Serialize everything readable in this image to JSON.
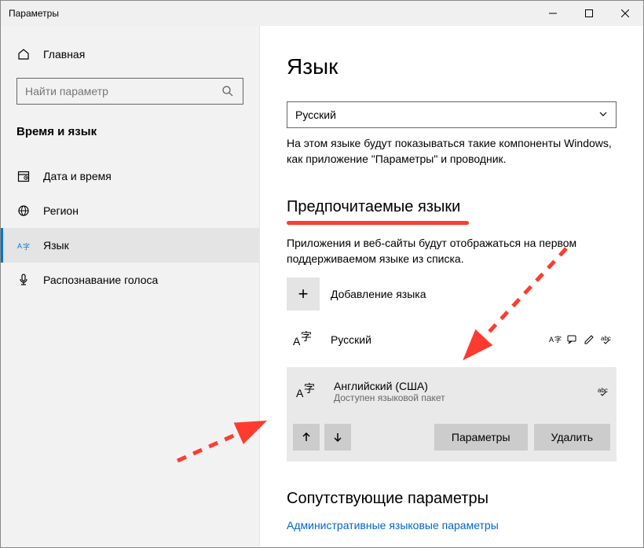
{
  "window": {
    "title": "Параметры"
  },
  "sidebar": {
    "home": "Главная",
    "search_placeholder": "Найти параметр",
    "category": "Время и язык",
    "items": [
      {
        "label": "Дата и время"
      },
      {
        "label": "Регион"
      },
      {
        "label": "Язык"
      },
      {
        "label": "Распознавание голоса"
      }
    ]
  },
  "main": {
    "title": "Язык",
    "dropdown_value": "Русский",
    "dropdown_desc": "На этом языке будут показываться такие компоненты Windows, как приложение \"Параметры\" и проводник.",
    "preferred_title": "Предпочитаемые языки",
    "preferred_desc": "Приложения и веб-сайты будут отображаться на первом поддерживаемом языке из списка.",
    "add_language": "Добавление языка",
    "languages": [
      {
        "name": "Русский",
        "sub": ""
      },
      {
        "name": "Английский (США)",
        "sub": "Доступен языковой пакет"
      }
    ],
    "btn_options": "Параметры",
    "btn_remove": "Удалить",
    "related_title": "Сопутствующие параметры",
    "related_link": "Административные языковые параметры"
  }
}
